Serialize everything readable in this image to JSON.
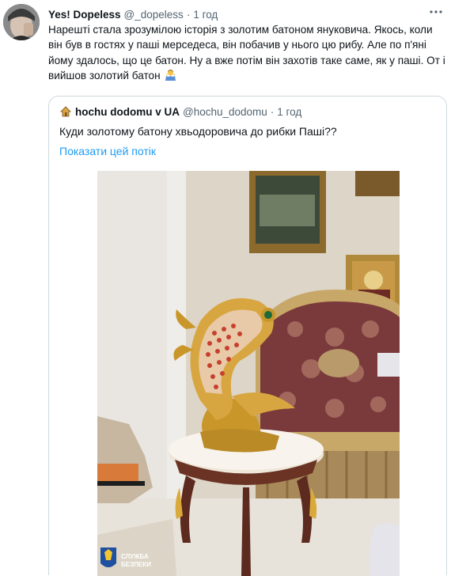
{
  "tweet": {
    "author_name": "Yes! Dopeless",
    "author_handle": "@_dopeless",
    "separator": "·",
    "time": "1 год",
    "text": "Нарешті стала зрозумілою історія з золотим батоном януковича. Якось, коли він був в гостях у паші мерседеса, він побачив у нього цю рибу. Але по п'яні йому здалось, що це батон. Ну а вже потім він захотів таке саме, як у паші. От і вийшов золотий батон"
  },
  "quote": {
    "author_name": "hochu dodomu v UA",
    "author_handle": "@hochu_dodomu",
    "separator": "·",
    "time": "1 год",
    "text": "Куди  золотому батону хвьодоровича до рибки Паші??",
    "show_thread": "Показати цей потік",
    "photo_watermark": [
      "СЛУЖБА",
      "БЕЗПЕКИ"
    ]
  },
  "icons": {
    "more": "more-horizontal-icon",
    "emoji": "man-shrugging-emoji-icon",
    "quote_avatar": "house-emoji-icon"
  },
  "colors": {
    "link": "#1d9bf0",
    "secondary_text": "#536471",
    "border": "#cfd9de"
  }
}
